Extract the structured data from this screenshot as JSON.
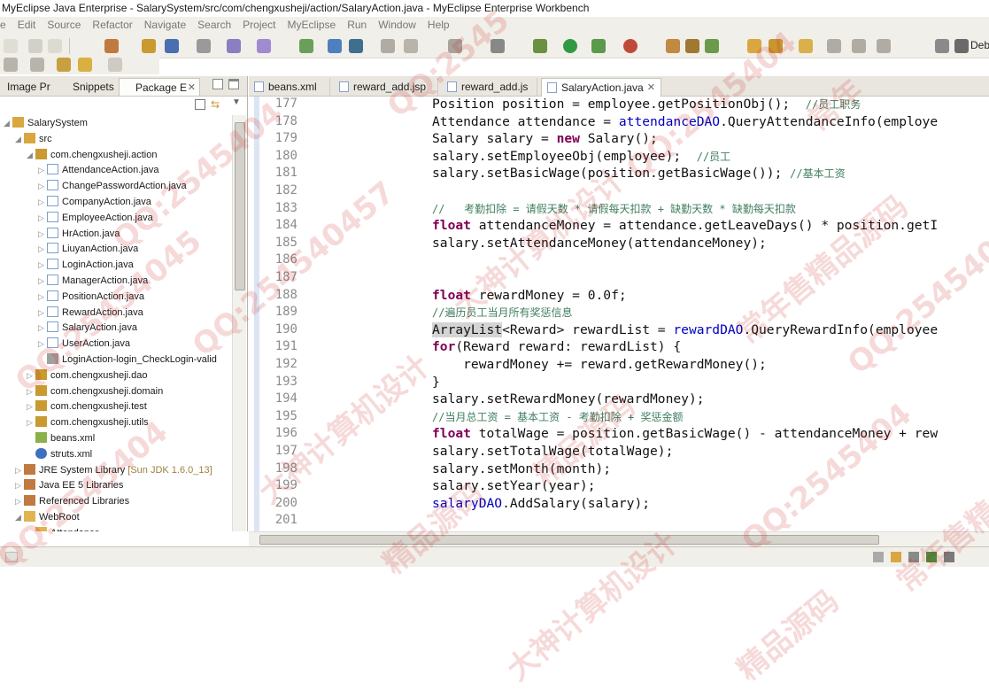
{
  "window": {
    "title": "MyEclipse Java Enterprise - SalarySystem/src/com/chengxusheji/action/SalaryAction.java - MyEclipse Enterprise Workbench"
  },
  "menu": [
    "e",
    "Edit",
    "Source",
    "Refactor",
    "Navigate",
    "Search",
    "Project",
    "MyEclipse",
    "Run",
    "Window",
    "Help"
  ],
  "perspective": {
    "label": "Debi"
  },
  "left_panel": {
    "tabs": [
      "Image Pr",
      "Snippets",
      "Package E"
    ],
    "tree": [
      {
        "label": "SalarySystem",
        "level": 0,
        "icon": "project",
        "expanded": true
      },
      {
        "label": "src",
        "level": 1,
        "icon": "src-folder",
        "expanded": true
      },
      {
        "label": "com.chengxusheji.action",
        "level": 2,
        "icon": "package",
        "expanded": true
      },
      {
        "label": "AttendanceAction.java",
        "level": 3,
        "icon": "java-file"
      },
      {
        "label": "ChangePasswordAction.java",
        "level": 3,
        "icon": "java-file"
      },
      {
        "label": "CompanyAction.java",
        "level": 3,
        "icon": "java-file"
      },
      {
        "label": "EmployeeAction.java",
        "level": 3,
        "icon": "java-file"
      },
      {
        "label": "HrAction.java",
        "level": 3,
        "icon": "java-file"
      },
      {
        "label": "LiuyanAction.java",
        "level": 3,
        "icon": "java-file"
      },
      {
        "label": "LoginAction.java",
        "level": 3,
        "icon": "java-file"
      },
      {
        "label": "ManagerAction.java",
        "level": 3,
        "icon": "java-file"
      },
      {
        "label": "PositionAction.java",
        "level": 3,
        "icon": "java-file"
      },
      {
        "label": "RewardAction.java",
        "level": 3,
        "icon": "java-file"
      },
      {
        "label": "SalaryAction.java",
        "level": 3,
        "icon": "java-file"
      },
      {
        "label": "UserAction.java",
        "level": 3,
        "icon": "java-file"
      },
      {
        "label": "LoginAction-login_CheckLogin-valid",
        "level": 3,
        "icon": "xml-file",
        "noarrow": true
      },
      {
        "label": "com.chengxusheji.dao",
        "level": 2,
        "icon": "package"
      },
      {
        "label": "com.chengxusheji.domain",
        "level": 2,
        "icon": "package"
      },
      {
        "label": "com.chengxusheji.test",
        "level": 2,
        "icon": "package"
      },
      {
        "label": "com.chengxusheji.utils",
        "level": 2,
        "icon": "package"
      },
      {
        "label": "beans.xml",
        "level": 2,
        "icon": "bean-file",
        "noarrow": true
      },
      {
        "label": "struts.xml",
        "level": 2,
        "icon": "gear-file",
        "noarrow": true
      },
      {
        "label": "JRE System Library",
        "suffix": " [Sun JDK 1.6.0_13]",
        "level": 1,
        "icon": "library"
      },
      {
        "label": "Java EE 5 Libraries",
        "level": 1,
        "icon": "library"
      },
      {
        "label": "Referenced Libraries",
        "level": 1,
        "icon": "library"
      },
      {
        "label": "WebRoot",
        "level": 1,
        "icon": "folder",
        "expanded": true
      },
      {
        "label": "Attendance",
        "level": 2,
        "icon": "folder"
      }
    ]
  },
  "editor": {
    "tabs": [
      "beans.xml",
      "reward_add.jsp",
      "reward_add.js",
      "SalaryAction.java"
    ],
    "active_tab": 3,
    "lines": [
      {
        "n": "177",
        "segs": [
          [
            "",
            "Position position = employee.getPositionObj();  "
          ],
          [
            "cm",
            "//员工职务"
          ]
        ]
      },
      {
        "n": "178",
        "segs": [
          [
            "",
            "Attendance attendance = "
          ],
          [
            "fld",
            "attendanceDAO"
          ],
          [
            "",
            ".QueryAttendanceInfo(employe"
          ]
        ]
      },
      {
        "n": "179",
        "segs": [
          [
            "",
            "Salary salary = "
          ],
          [
            "kw",
            "new"
          ],
          [
            "",
            " Salary();"
          ]
        ]
      },
      {
        "n": "180",
        "segs": [
          [
            "",
            "salary.setEmployeeObj(employee);  "
          ],
          [
            "cm",
            "//员工"
          ]
        ]
      },
      {
        "n": "181",
        "segs": [
          [
            "",
            "salary.setBasicWage(position.getBasicWage()); "
          ],
          [
            "cm",
            "//基本工资"
          ]
        ]
      },
      {
        "n": "182",
        "segs": []
      },
      {
        "n": "183",
        "segs": [
          [
            "cm",
            "//   考勤扣除 = 请假天数 * 请假每天扣款 + 缺勤天数 * 缺勤每天扣款"
          ]
        ]
      },
      {
        "n": "184",
        "segs": [
          [
            "kw",
            "float"
          ],
          [
            "",
            " attendanceMoney = attendance.getLeaveDays() * position.getI"
          ]
        ]
      },
      {
        "n": "185",
        "segs": [
          [
            "",
            "salary.setAttendanceMoney(attendanceMoney);"
          ]
        ]
      },
      {
        "n": "186",
        "segs": []
      },
      {
        "n": "187",
        "segs": []
      },
      {
        "n": "188",
        "segs": [
          [
            "kw",
            "float"
          ],
          [
            "",
            " rewardMoney = 0.0f;"
          ]
        ]
      },
      {
        "n": "189",
        "segs": [
          [
            "cm",
            "//遍历员工当月所有奖惩信息"
          ]
        ]
      },
      {
        "n": "190",
        "segs": [
          [
            "hl",
            "ArrayList"
          ],
          [
            "",
            "<Reward> rewardList = "
          ],
          [
            "fld",
            "rewardDAO"
          ],
          [
            "",
            ".QueryRewardInfo(employee"
          ]
        ]
      },
      {
        "n": "191",
        "segs": [
          [
            "kw",
            "for"
          ],
          [
            "",
            "(Reward reward: rewardList) {"
          ]
        ]
      },
      {
        "n": "192",
        "segs": [
          [
            "",
            "    rewardMoney += reward.getRewardMoney();"
          ]
        ]
      },
      {
        "n": "193",
        "segs": [
          [
            "",
            "}"
          ]
        ]
      },
      {
        "n": "194",
        "segs": [
          [
            "",
            "salary.setRewardMoney(rewardMoney);"
          ]
        ]
      },
      {
        "n": "195",
        "segs": [
          [
            "cm",
            "//当月总工资 = 基本工资 - 考勤扣除 + 奖惩金额"
          ]
        ]
      },
      {
        "n": "196",
        "segs": [
          [
            "kw",
            "float"
          ],
          [
            "",
            " totalWage = position.getBasicWage() - attendanceMoney + rew"
          ]
        ]
      },
      {
        "n": "197",
        "segs": [
          [
            "",
            "salary.setTotalWage(totalWage);"
          ]
        ]
      },
      {
        "n": "198",
        "segs": [
          [
            "",
            "salary.setMonth(month);"
          ]
        ]
      },
      {
        "n": "199",
        "segs": [
          [
            "",
            "salary.setYear(year);"
          ]
        ]
      },
      {
        "n": "200",
        "segs": [
          [
            "fld",
            "salaryDAO"
          ],
          [
            "",
            ".AddSalary(salary);"
          ]
        ]
      },
      {
        "n": "201",
        "segs": []
      }
    ]
  },
  "watermarks": [
    "QQ:2545404",
    "QQ:254540457",
    "QQ:2545",
    "QQ:2545404",
    "大神计算机设计",
    "精品源码",
    "常年售精品源码",
    "QQ:25454045",
    "大神计算机设计",
    "精品源码",
    "常年",
    "QQ:2545404",
    "QQ:25454045",
    "QQ:2545404",
    "大神计算机设计",
    "精品源码",
    "常年售精品源码"
  ],
  "colors": {
    "keyword": "#7f0055",
    "field": "#0000c0",
    "comment": "#3f7f5f",
    "watermark": "#c81e1e"
  }
}
